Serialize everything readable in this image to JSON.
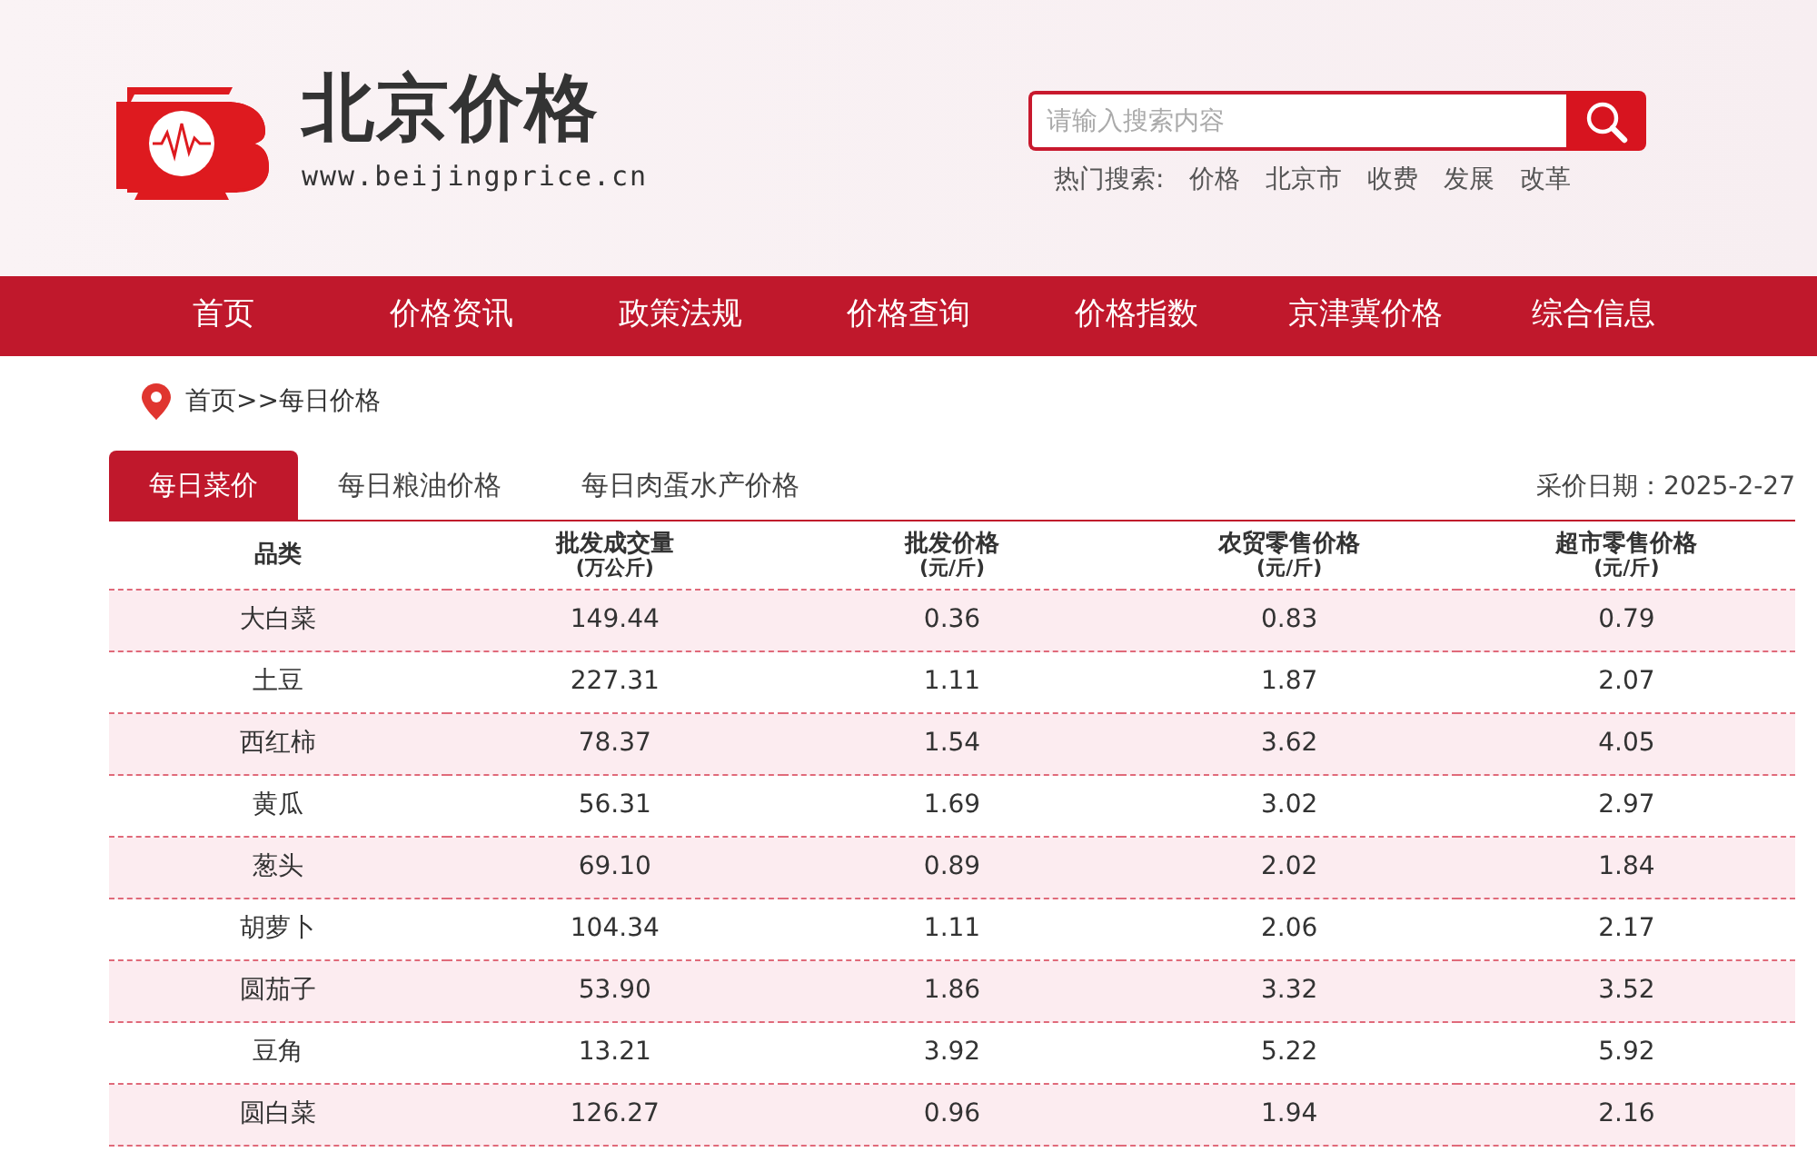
{
  "site": {
    "title": "北京价格",
    "url": "www.beijingprice.cn"
  },
  "search": {
    "placeholder": "请输入搜索内容",
    "hot_label": "热门搜索:",
    "hot_terms": [
      "价格",
      "北京市",
      "收费",
      "发展",
      "改革"
    ]
  },
  "nav": [
    "首页",
    "价格资讯",
    "政策法规",
    "价格查询",
    "价格指数",
    "京津冀价格",
    "综合信息"
  ],
  "breadcrumb": "首页>>每日价格",
  "tabs": [
    {
      "label": "每日菜价",
      "selected": true
    },
    {
      "label": "每日粮油价格",
      "selected": false
    },
    {
      "label": "每日肉蛋水产价格",
      "selected": false
    }
  ],
  "date": "采价日期：2025-2-27",
  "table": {
    "columns": [
      {
        "title": "品类"
      },
      {
        "title": "批发成交量",
        "unit": "(万公斤)"
      },
      {
        "title": "批发价格",
        "unit": "(元/斤)"
      },
      {
        "title": "农贸零售价格",
        "unit": "(元/斤)"
      },
      {
        "title": "超市零售价格",
        "unit": "(元/斤)"
      }
    ],
    "rows": [
      [
        "大白菜",
        "149.44",
        "0.36",
        "0.83",
        "0.79"
      ],
      [
        "土豆",
        "227.31",
        "1.11",
        "1.87",
        "2.07"
      ],
      [
        "西红柿",
        "78.37",
        "1.54",
        "3.62",
        "4.05"
      ],
      [
        "黄瓜",
        "56.31",
        "1.69",
        "3.02",
        "2.97"
      ],
      [
        "葱头",
        "69.10",
        "0.89",
        "2.02",
        "1.84"
      ],
      [
        "胡萝卜",
        "104.34",
        "1.11",
        "2.06",
        "2.17"
      ],
      [
        "圆茄子",
        "53.90",
        "1.86",
        "3.32",
        "3.52"
      ],
      [
        "豆角",
        "13.21",
        "3.92",
        "5.22",
        "5.92"
      ],
      [
        "圆白菜",
        "126.27",
        "0.96",
        "1.94",
        "2.16"
      ]
    ]
  }
}
